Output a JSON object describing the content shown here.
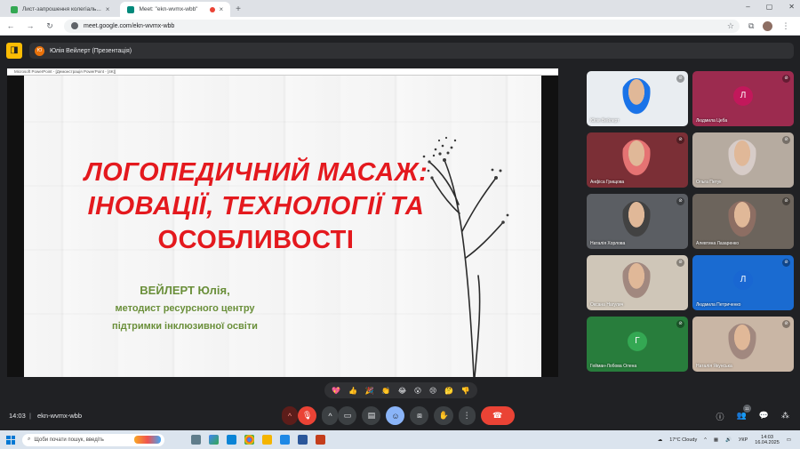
{
  "browser": {
    "tabs": [
      {
        "title": "Лист-запрошення колегіаль...",
        "active": false,
        "color": "#34a853"
      },
      {
        "title": "Meet: \"ekn-wvmx-wbb\"",
        "active": true,
        "color": "#00897b"
      }
    ],
    "new_tab": "+",
    "url": "meet.google.com/ekn-wvmx-wbb",
    "window_controls": [
      "–",
      "▢",
      "✕"
    ]
  },
  "meet": {
    "presenter_initial": "Ю",
    "presenter_label": "Юлія Вейлерт (Презентація)",
    "pp_window_title": "Microsoft PowerPoint - [Демонстрація PowerPoint - [4K]]",
    "slide": {
      "title_line1": "ЛОГОПЕДИЧНИЙ МАСАЖ:",
      "title_line2": "ІНОВАЦІЇ, ТЕХНОЛОГІЇ ТА",
      "title_line3": "ОСОБЛИВОСТІ",
      "author_name": "ВЕЙЛЕРТ Юлія,",
      "author_line2": "методист ресурсного центру",
      "author_line3": "підтримки інклюзивної освіти"
    },
    "participants": [
      {
        "name": "Юлія Вейлерт",
        "initial": "",
        "bg": "#e9edf1",
        "accent": "#1a73e8"
      },
      {
        "name": "Людмила Цеба",
        "initial": "Л",
        "bg": "#9c2b4f",
        "accent": "#c2185b"
      },
      {
        "name": "Анфіса Грищова",
        "initial": "",
        "bg": "#7b2f36",
        "accent": "#e57373"
      },
      {
        "name": "Ольга Петук",
        "initial": "",
        "bg": "#b6aba0",
        "accent": "#d7ccc8"
      },
      {
        "name": "Наталія Хорлова",
        "initial": "",
        "bg": "#5b5e63",
        "accent": "#424242"
      },
      {
        "name": "Алевтина Лазаренко",
        "initial": "",
        "bg": "#6c645c",
        "accent": "#8d6e63"
      },
      {
        "name": "Оксана Нагулич",
        "initial": "",
        "bg": "#cfc6b8",
        "accent": "#a1887f"
      },
      {
        "name": "Людмила Петриченко",
        "initial": "Л",
        "bg": "#1a6bd1",
        "accent": "#1967d2"
      },
      {
        "name": "Гейман-Лобова Олена",
        "initial": "Г",
        "bg": "#287d3c",
        "accent": "#34a853"
      },
      {
        "name": "Наталія Якунська",
        "initial": "",
        "bg": "#c9b6a5",
        "accent": "#a1887f"
      }
    ],
    "reactions": [
      "💖",
      "👍",
      "🎉",
      "👏",
      "😂",
      "😮",
      "😢",
      "🤔",
      "👎"
    ],
    "time": "14:03",
    "separator": "|",
    "meeting_code": "ekn-wvmx-wbb",
    "participant_count": "11"
  },
  "taskbar": {
    "search_placeholder": "Щоби почати пошук, введіть",
    "weather": "17°C  Cloudy",
    "language": "УКР",
    "time": "14:03",
    "date": "16.04.2025"
  },
  "colors": {
    "title_red": "#e4191e",
    "author_green": "#6a8f3a",
    "end_call": "#ea4335"
  }
}
